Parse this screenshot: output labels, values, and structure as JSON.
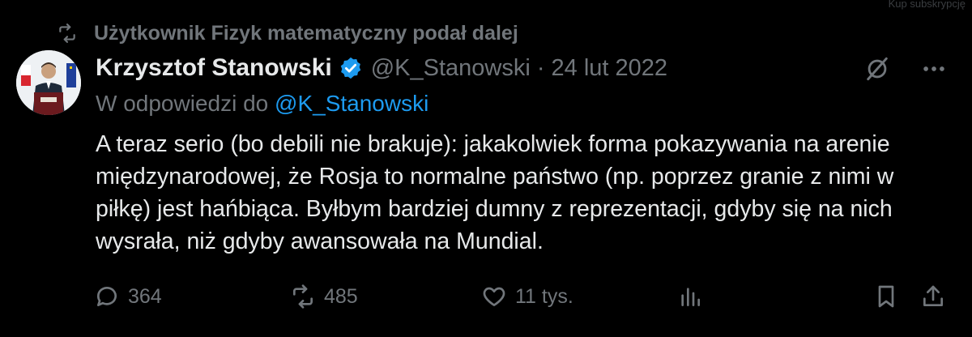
{
  "top_fade_text": "Kup subskrypcję",
  "repost": {
    "text": "Użytkownik Fizyk matematyczny podał dalej",
    "icon": "repost-icon"
  },
  "author": {
    "name": "Krzysztof Stanowski",
    "handle": "@K_Stanowski",
    "separator": "·",
    "date": "24 lut 2022",
    "verified": true
  },
  "reply_to": {
    "prefix": "W odpowiedzi do ",
    "mention": "@K_Stanowski"
  },
  "tweet": {
    "text": "A teraz serio (bo debili nie brakuje): jakakolwiek forma pokazywania na arenie międzynarodowej, że Rosja to normalne państwo (np. poprzez granie z nimi w piłkę) jest hańbiąca. Byłbym bardziej dumny z reprezentacji, gdyby się na nich wysrała, niż gdyby awansowała na Mundial."
  },
  "actions": {
    "replies": "364",
    "reposts": "485",
    "likes": "11 tys."
  },
  "colors": {
    "background": "#000000",
    "text": "#e7e9ea",
    "muted": "#71767b",
    "accent": "#1d9bf0"
  }
}
